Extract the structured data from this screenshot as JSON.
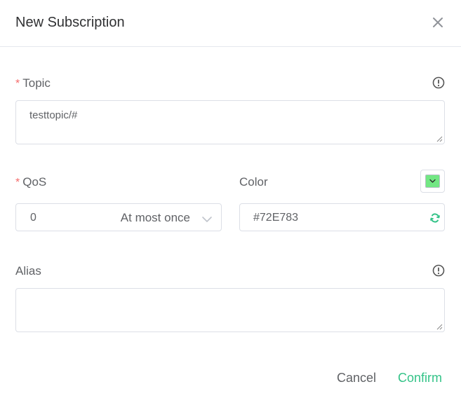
{
  "dialog": {
    "title": "New Subscription",
    "close_icon": "close-icon"
  },
  "topic": {
    "required_mark": "*",
    "label": "Topic",
    "value": "testtopic/#",
    "info_icon": "info-icon"
  },
  "qos": {
    "required_mark": "*",
    "label": "QoS",
    "value": "0",
    "value_desc": "At most once",
    "chevron_icon": "chevron-down-icon"
  },
  "color": {
    "label": "Color",
    "value": "#72E783",
    "swatch_color": "#72E783",
    "refresh_icon": "refresh-icon",
    "accent": "#34c388"
  },
  "alias": {
    "label": "Alias",
    "value": "",
    "info_icon": "info-icon"
  },
  "footer": {
    "cancel_label": "Cancel",
    "confirm_label": "Confirm"
  }
}
